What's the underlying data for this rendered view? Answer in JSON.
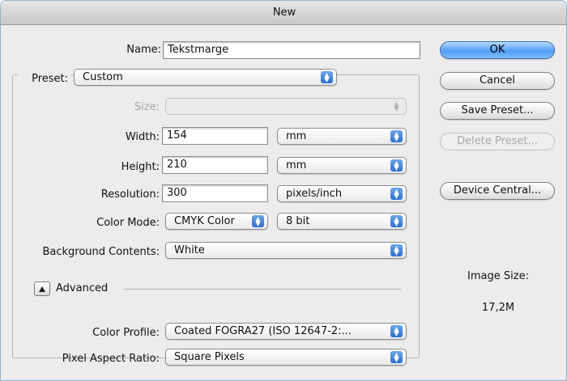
{
  "window": {
    "title": "New"
  },
  "fields": {
    "name_label": "Name:",
    "name_value": "Tekstmarge",
    "preset_label": "Preset:",
    "preset_value": "Custom",
    "size_label": "Size:",
    "size_value": "",
    "width_label": "Width:",
    "width_value": "154",
    "width_unit": "mm",
    "height_label": "Height:",
    "height_value": "210",
    "height_unit": "mm",
    "resolution_label": "Resolution:",
    "resolution_value": "300",
    "resolution_unit": "pixels/inch",
    "color_mode_label": "Color Mode:",
    "color_mode_value": "CMYK Color",
    "bit_depth_value": "8 bit",
    "background_label": "Background Contents:",
    "background_value": "White",
    "advanced_label": "Advanced",
    "color_profile_label": "Color Profile:",
    "color_profile_value": "Coated FOGRA27 (ISO 12647-2:...",
    "pixel_aspect_label": "Pixel Aspect Ratio:",
    "pixel_aspect_value": "Square Pixels"
  },
  "buttons": {
    "ok": "OK",
    "cancel": "Cancel",
    "save_preset": "Save Preset...",
    "delete_preset": "Delete Preset...",
    "device_central": "Device Central..."
  },
  "image_size": {
    "label": "Image Size:",
    "value": "17,2M"
  },
  "icons": {
    "popup_arrows": "updown-arrows-icon",
    "disclosure": "disclosure-triangle-up-icon"
  },
  "colors": {
    "accent": "#4e9ef5",
    "window_border": "#8fb2cf"
  }
}
